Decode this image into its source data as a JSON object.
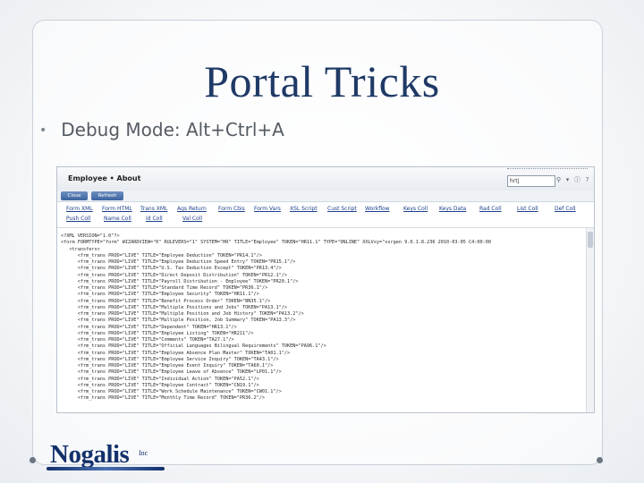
{
  "slide": {
    "title": "Portal Tricks",
    "bullet": "Debug Mode: Alt+Ctrl+A"
  },
  "screenshot": {
    "window_title": "Employee • About",
    "search_value": "hrtj",
    "buttons": [
      "Close",
      "Refresh"
    ],
    "links_row1": [
      "Form XML",
      "Form HTML",
      "Trans XML",
      "Ags Return",
      "Form Cbis",
      "Form Vars",
      "XSL Script",
      "Cust Script",
      "Workflow",
      "Keys Coll",
      "Keys Data",
      "Rad Coll",
      "List Coll",
      "Def Coll"
    ],
    "links_row2": [
      "Push Coll",
      "Name Coll",
      "Id Coll",
      "Val Coll"
    ],
    "code_lines": [
      "<?XML VERSION=\"1.0\"?>",
      "<form FORMTYPE=\"form\" WIZARDVIEW=\"0\" RULEVERS=\"1\" SYSTEM=\"HR\" TITLE=\"Employee\" TOKEN=\"HR11.1\" TYPE=\"ONLINE\" XXLVxy=\"xsrgen 9.0.1.8.236 2010-03-05 C4:00:00",
      "   <transfers>",
      "      <frm_trans PROD=\"LIVE\" TITLE=\"Employee Deduction\" TOKEN=\"PR14.1\"/>",
      "      <frm_trans PROD=\"LIVE\" TITLE=\"Employee Deduction Speed Entry\" TOKEN=\"PR15.1\"/>",
      "      <frm_trans PROD=\"LIVE\" TITLE=\"U.S. Tax Deduction Except\" TOKEN=\"PR13.4\"/>",
      "      <frm_trans PROD=\"LIVE\" TITLE=\"Direct Deposit Distribution\" TOKEN=\"PR12.1\"/>",
      "      <frm_trans PROD=\"LIVE\" TITLE=\"Payroll Distribution - Employee\" TOKEN=\"PR20.1\"/>",
      "      <frm_trans PROD=\"LIVE\" TITLE=\"Standard Time Record\" TOKEN=\"PR36.1\"/>",
      "      <frm_trans PROD=\"LIVE\" TITLE=\"Employee Security\" TOKEN=\"HR11.1\"/>",
      "      <frm_trans PROD=\"LIVE\" TITLE=\"Benefit Process Order\" TOKEN=\"BN35.1\"/>",
      "      <frm_trans PROD=\"LIVE\" TITLE=\"Multiple Positions and Jobs\" TOKEN=\"PA13.1\"/>",
      "      <frm_trans PROD=\"LIVE\" TITLE=\"Multiple Position and Job History\" TOKEN=\"PA13.2\"/>",
      "      <frm_trans PROD=\"LIVE\" TITLE=\"Multiple Position, Job Summary\" TOKEN=\"PA13.3\"/>",
      "      <frm_trans PROD=\"LIVE\" TITLE=\"Dependent\" TOKEN=\"HR13.1\"/>",
      "      <frm_trans PROD=\"LIVE\" TITLE=\"Employee Listing\" TOKEN=\"HR211\"/>",
      "      <frm_trans PROD=\"LIVE\" TITLE=\"Comments\" TOKEN=\"TA27.1\"/>",
      "      <frm_trans PROD=\"LIVE\" TITLE=\"Official Languages Bilingual Requirements\" TOKEN=\"PA96.1\"/>",
      "      <frm_trans PROD=\"LIVE\" TITLE=\"Employee Absence Plan Master\" TOKEN=\"TA01.1\"/>",
      "      <frm_trans PROD=\"LIVE\" TITLE=\"Employee Service Inquiry\" TOKEN=\"TA43.1\"/>",
      "      <frm_trans PROD=\"LIVE\" TITLE=\"Employee Event Inquiry\" TOKEN=\"TA60.1\"/>",
      "      <frm_trans PROD=\"LIVE\" TITLE=\"Employee Leave of Absence\" TOKEN=\"LP01.1\"/>",
      "      <frm_trans PROD=\"LIVE\" TITLE=\"Individual Action\" TOKEN=\"PA52.1\"/>",
      "      <frm_trans PROD=\"LIVE\" TITLE=\"Employee Contract\" TOKEN=\"CN19.1\"/>",
      "      <frm_trans PROD=\"LIVE\" TITLE=\"Work Schedule Maintenance\" TOKEN=\"CW01.1\"/>",
      "      <frm_trans PROD=\"LIVE\" TITLE=\"Monthly Time Record\" TOKEN=\"PR36.2\"/>"
    ]
  },
  "logo": {
    "name": "Nogalis",
    "suffix": "Inc"
  },
  "colors": {
    "title": "#1f3a66",
    "link": "#1b3f8a",
    "button": "#3d64a0",
    "logo": "#13306b"
  }
}
